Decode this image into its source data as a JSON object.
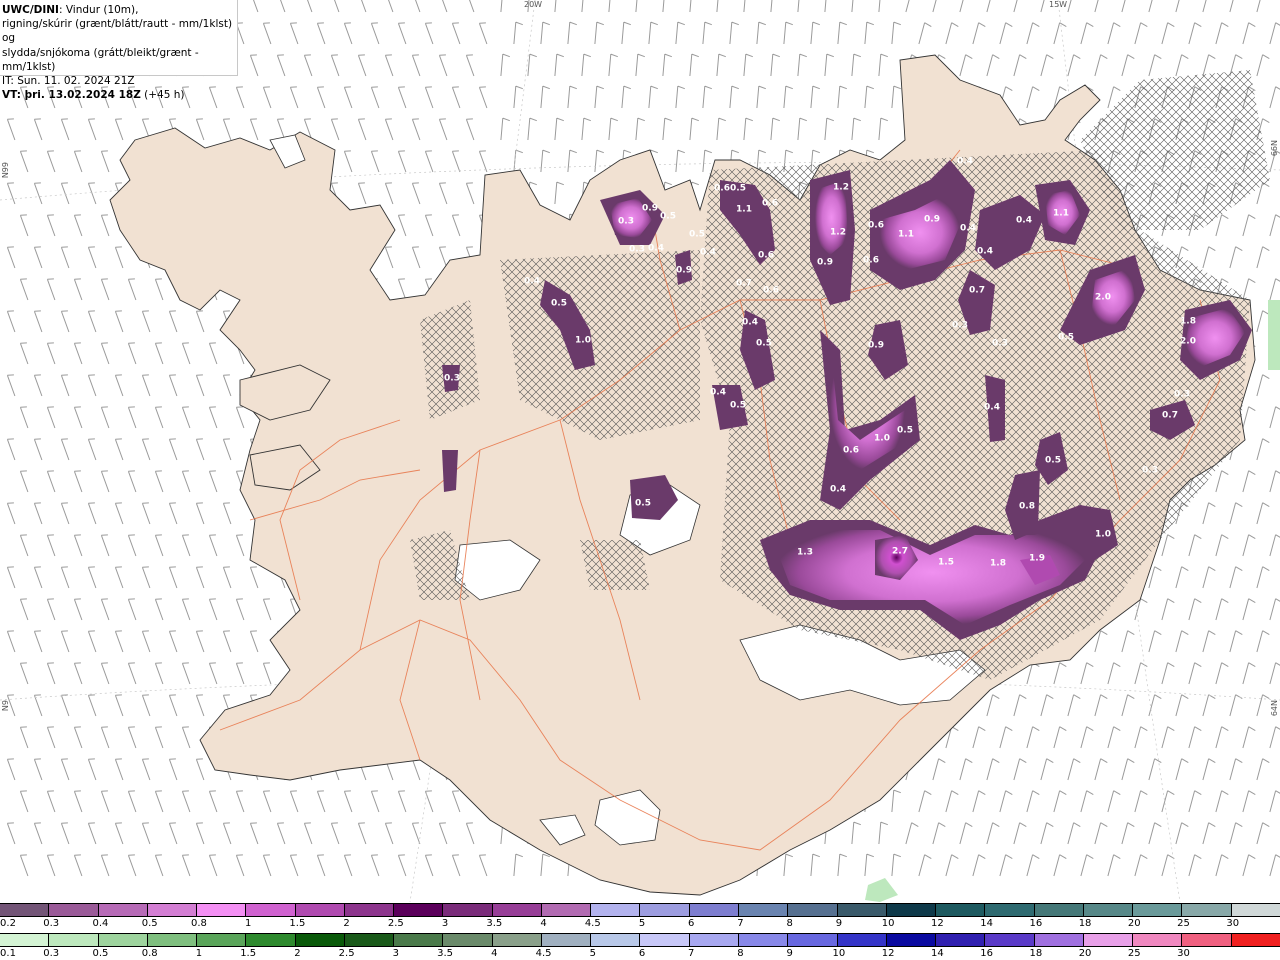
{
  "header": {
    "line1_bold": "UWC/DINI",
    "line1_rest": ": Vindur (10m),",
    "line2": "rigning/skúrir (grænt/blátt/rautt - mm/1klst) og",
    "line3": "slydda/snjókoma (grátt/bleikt/grænt - mm/1klst)",
    "line4": "IT: Sun. 11. 02. 2024 21Z",
    "line5_bold": "VT: þri. 13.02.2024 18Z",
    "line5_rest": " (+45 h)"
  },
  "graticule_labels": {
    "top_left": "20W",
    "top_right": "15W",
    "left_upper": "N99",
    "left_lower": "N9",
    "right_upper": "66N",
    "right_lower": "64N"
  },
  "colors": {
    "land": "#f1e1d2",
    "roads": "#e8794e",
    "coast": "#333333",
    "barbs": "#999999"
  },
  "precip_values": [
    {
      "label": "0.4",
      "value": 0.4
    },
    {
      "label": "1.2",
      "value": 1.2
    },
    {
      "label": "1.2",
      "value": 1.2
    },
    {
      "label": "0.9",
      "value": 0.9
    },
    {
      "label": "0.6",
      "value": 0.6
    },
    {
      "label": "1.1",
      "value": 1.1
    },
    {
      "label": "0.9",
      "value": 0.9
    },
    {
      "label": "0.6",
      "value": 0.6
    },
    {
      "label": "0.4",
      "value": 0.4
    },
    {
      "label": "0.4",
      "value": 0.4
    },
    {
      "label": "1.1",
      "value": 1.1
    },
    {
      "label": "0.4",
      "value": 0.4
    },
    {
      "label": "2.0",
      "value": 2.0
    },
    {
      "label": "0.5",
      "value": 0.5
    },
    {
      "label": "1.8",
      "value": 1.8
    },
    {
      "label": "2.0",
      "value": 2.0
    },
    {
      "label": "0.7",
      "value": 0.7
    },
    {
      "label": "0.3",
      "value": 0.3
    },
    {
      "label": "0.3",
      "value": 0.3
    },
    {
      "label": "0.4",
      "value": 0.4
    },
    {
      "label": "0.3",
      "value": 0.3
    },
    {
      "label": "0.7",
      "value": 0.7
    },
    {
      "label": "0.3",
      "value": 0.3
    },
    {
      "label": "0.9",
      "value": 0.9
    },
    {
      "label": "0.6",
      "value": 0.6
    },
    {
      "label": "1.0",
      "value": 1.0
    },
    {
      "label": "0.5",
      "value": 0.5
    },
    {
      "label": "0.4",
      "value": 0.4
    },
    {
      "label": "0.5",
      "value": 0.5
    },
    {
      "label": "0.8",
      "value": 0.8
    },
    {
      "label": "1.3",
      "value": 1.3
    },
    {
      "label": "2.7",
      "value": 2.7
    },
    {
      "label": "1.5",
      "value": 1.5
    },
    {
      "label": "1.8",
      "value": 1.8
    },
    {
      "label": "1.9",
      "value": 1.9
    },
    {
      "label": "1.0",
      "value": 1.0
    },
    {
      "label": "0.5",
      "value": 0.5
    },
    {
      "label": "0.3",
      "value": 0.3
    },
    {
      "label": "0.3",
      "value": 0.3
    },
    {
      "label": "0.5",
      "value": 0.5
    },
    {
      "label": "1.0",
      "value": 1.0
    },
    {
      "label": "0.4",
      "value": 0.4
    },
    {
      "label": "0.5",
      "value": 0.5
    },
    {
      "label": "0.3",
      "value": 0.3
    },
    {
      "label": "0.6",
      "value": 0.6
    },
    {
      "label": "0.3",
      "value": 0.3
    },
    {
      "label": "0.9",
      "value": 0.9
    },
    {
      "label": "0.4",
      "value": 0.4
    },
    {
      "label": "0.5",
      "value": 0.5
    },
    {
      "label": "0.4",
      "value": 0.4
    },
    {
      "label": "0.6",
      "value": 0.6
    },
    {
      "label": "0.5",
      "value": 0.5
    },
    {
      "label": "0.7",
      "value": 0.7
    },
    {
      "label": "0.9",
      "value": 0.9
    },
    {
      "label": "0.6",
      "value": 0.6
    },
    {
      "label": "1.1",
      "value": 1.1
    },
    {
      "label": "0.6",
      "value": 0.6
    },
    {
      "label": "0.4",
      "value": 0.4
    },
    {
      "label": "0.5",
      "value": 0.5
    },
    {
      "label": "0.4",
      "value": 0.4
    },
    {
      "label": "0.5",
      "value": 0.5
    }
  ],
  "legend_snow": {
    "labels": [
      "0.2",
      "0.3",
      "0.4",
      "0.5",
      "0.8",
      "1",
      "1.5",
      "2",
      "2.5",
      "3",
      "3.5",
      "4",
      "4.5",
      "5",
      "6",
      "7",
      "8",
      "9",
      "10",
      "12",
      "14",
      "16",
      "18",
      "20",
      "25",
      "30"
    ],
    "colors": [
      "#735577",
      "#9a5a98",
      "#b76bb7",
      "#d37ed3",
      "#f38ff3",
      "#d062d0",
      "#b04ab0",
      "#8d358d",
      "#5b005b",
      "#7a2b7a",
      "#973e97",
      "#b26bb2",
      "#b3b3ee",
      "#9d9de0",
      "#7e7ed0",
      "#6a84b0",
      "#567090",
      "#3a5a6a",
      "#0f3a4a",
      "#1e5a60",
      "#2e6a70",
      "#457878",
      "#578888",
      "#6a9a9a",
      "#88a8a8",
      "#d0d8d8"
    ]
  },
  "legend_rain": {
    "labels": [
      "0.1",
      "0.3",
      "0.5",
      "0.8",
      "1",
      "1.5",
      "2",
      "2.5",
      "3",
      "3.5",
      "4",
      "4.5",
      "5",
      "6",
      "7",
      "8",
      "9",
      "10",
      "12",
      "14",
      "16",
      "18",
      "20",
      "25",
      "30"
    ],
    "colors": [
      "#d4f4d4",
      "#bde8bd",
      "#9ed49e",
      "#7fbf7f",
      "#5aa55a",
      "#2e8a2e",
      "#0a5a0a",
      "#1a5a1a",
      "#4a7a4a",
      "#6a8a6a",
      "#8aa08a",
      "#a0b0c0",
      "#b8c8e8",
      "#c8c8f8",
      "#a8a8f0",
      "#8888e8",
      "#6868e0",
      "#3434c8",
      "#0a0aa0",
      "#3020b0",
      "#5a3ac8",
      "#a070e0",
      "#e8a0e8",
      "#f088c0",
      "#f06080",
      "#f02020"
    ]
  }
}
